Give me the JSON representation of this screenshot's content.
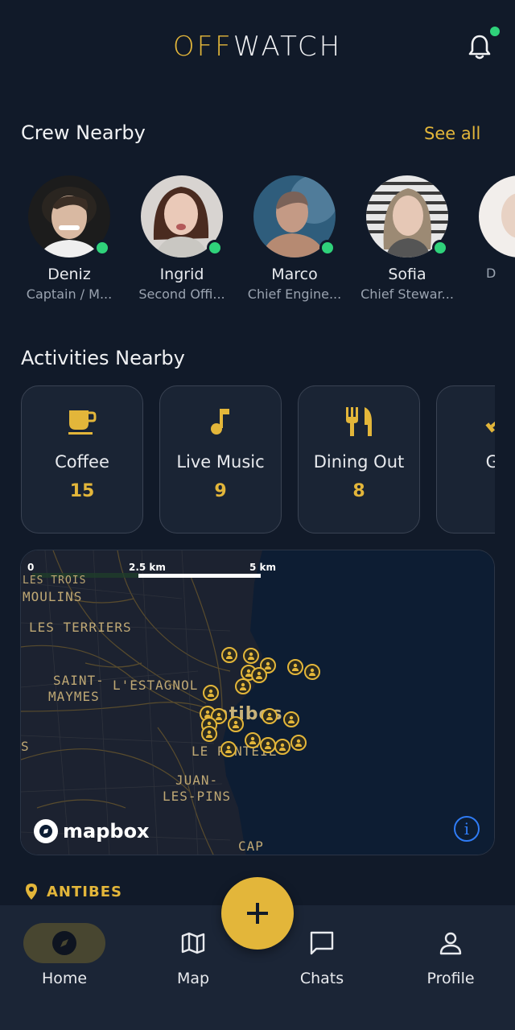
{
  "app": {
    "logo_part1": "OFF",
    "logo_part2": "WATCH",
    "accent": "#e3b63a"
  },
  "crew": {
    "title": "Crew Nearby",
    "see_all": "See all",
    "members": [
      {
        "name": "Deniz",
        "role": "Captain / M...",
        "online": true
      },
      {
        "name": "Ingrid",
        "role": "Second Offi...",
        "online": true
      },
      {
        "name": "Marco",
        "role": "Chief Engine...",
        "online": true
      },
      {
        "name": "Sofia",
        "role": "Chief Stewar...",
        "online": true
      },
      {
        "name": "",
        "role": "D",
        "online": false
      }
    ]
  },
  "activities": {
    "title": "Activities Nearby",
    "items": [
      {
        "label": "Coffee",
        "count": "15",
        "icon": "coffee-icon"
      },
      {
        "label": "Live Music",
        "count": "9",
        "icon": "music-note-icon"
      },
      {
        "label": "Dining Out",
        "count": "8",
        "icon": "cutlery-icon"
      },
      {
        "label": "Gy",
        "count": "",
        "icon": "dumbbell-icon"
      }
    ]
  },
  "map": {
    "scale": [
      "0",
      "2.5 km",
      "5 km"
    ],
    "labels": [
      "LES TROIS",
      "MOULINS",
      "LES TERRIERS",
      "SAINT-",
      "MAYMES",
      "L'ESTAGNOL",
      "Antibes",
      "LE PONTEIL",
      "JUAN-",
      "LES-PINS",
      "CAP",
      "S"
    ],
    "attribution": "mapbox",
    "info": "i"
  },
  "location": {
    "city": "ANTIBES"
  },
  "nav": {
    "home": "Home",
    "map": "Map",
    "chats": "Chats",
    "profile": "Profile",
    "fab": "+"
  }
}
